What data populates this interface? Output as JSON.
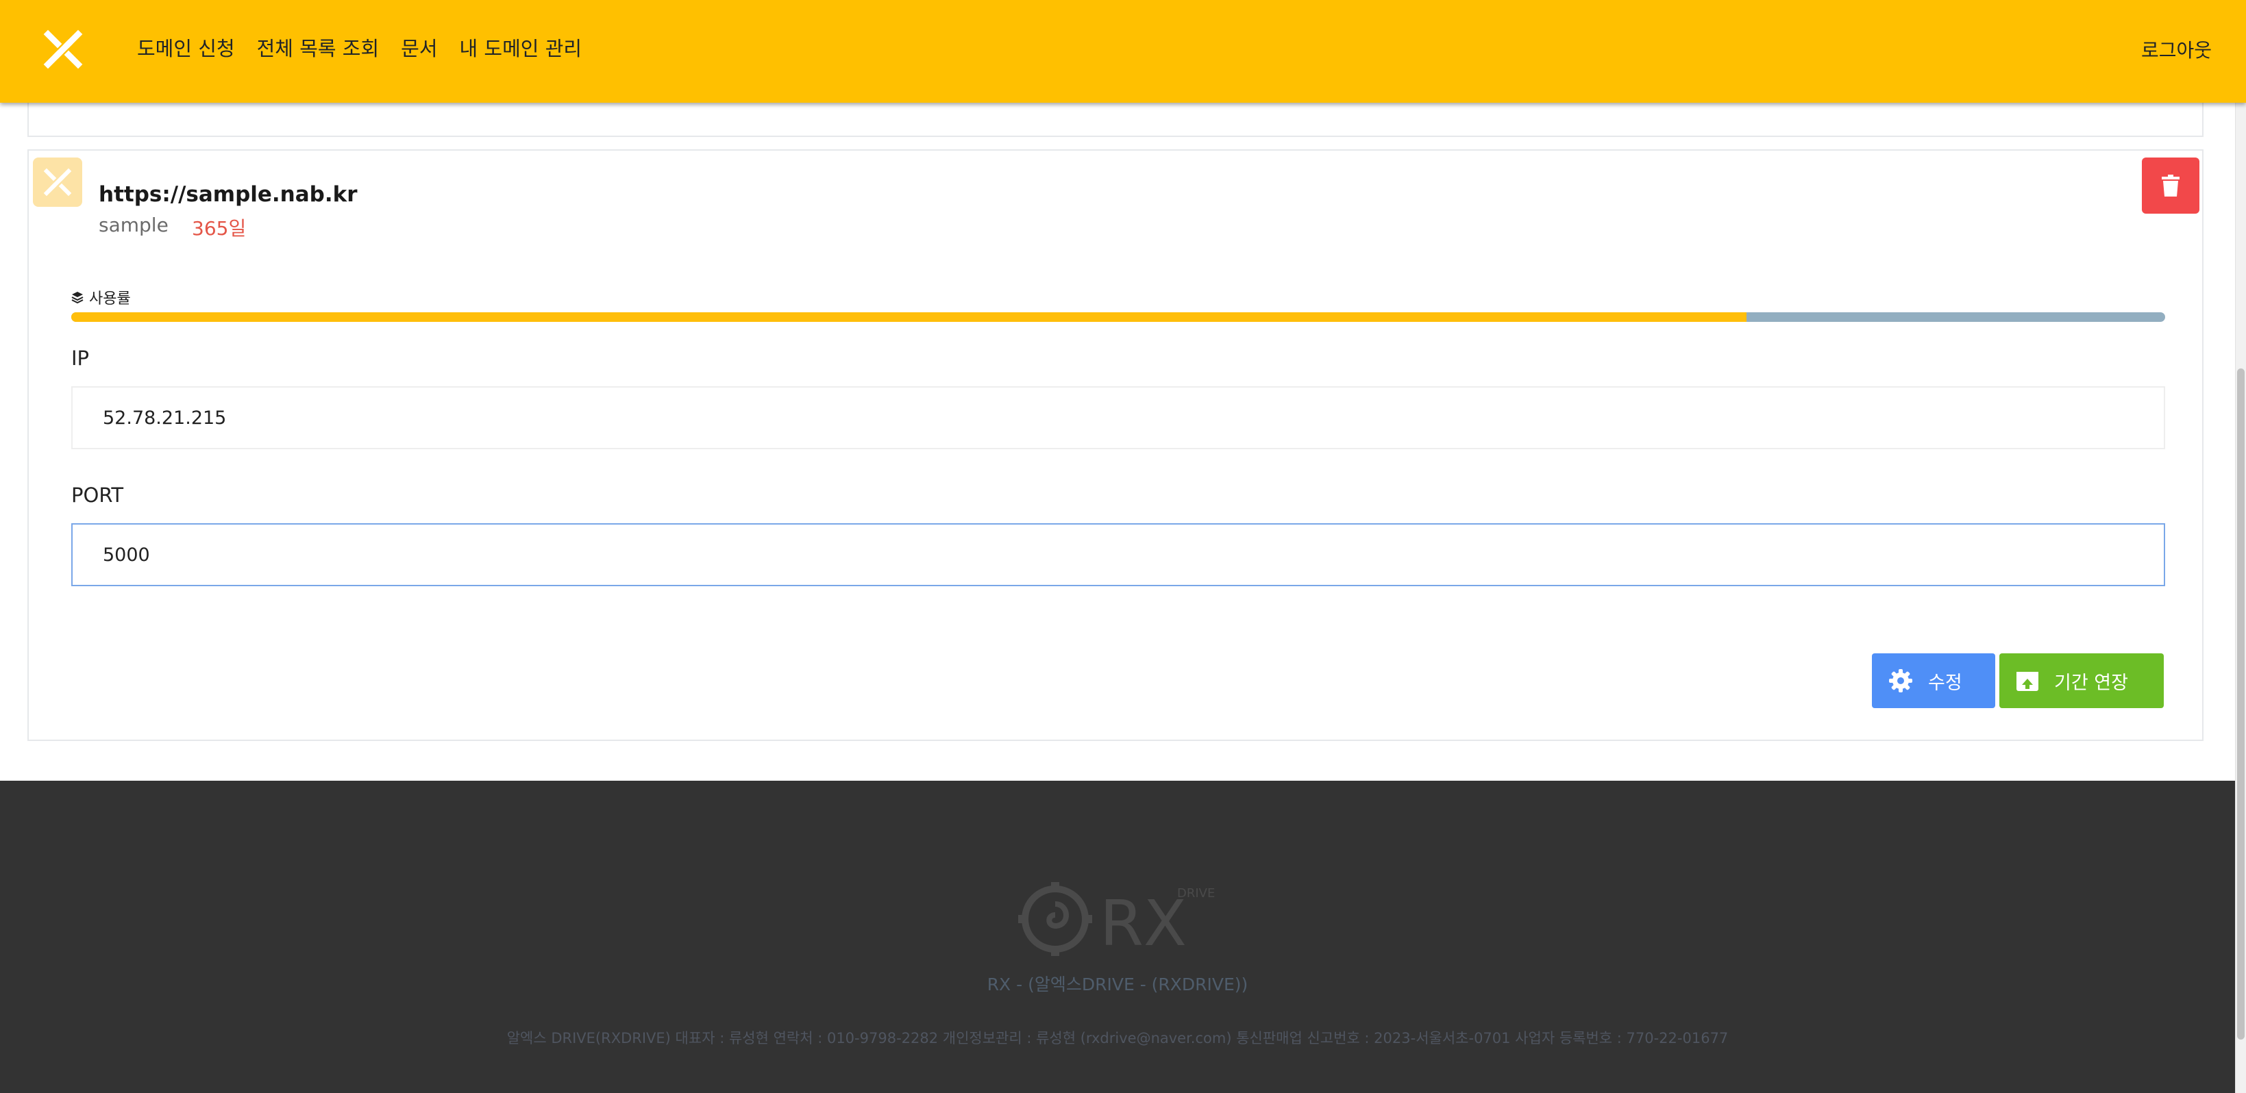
{
  "header": {
    "nav": [
      {
        "label": "도메인 신청"
      },
      {
        "label": "전체 목록 조회"
      },
      {
        "label": "문서"
      },
      {
        "label": "내 도메인 관리"
      }
    ],
    "logout_label": "로그아웃",
    "brand_color": "#ffc000"
  },
  "domain": {
    "url": "https://sample.nab.kr",
    "name": "sample",
    "days_left": "365일",
    "usage_label": "사용률",
    "usage_percent": 80,
    "ip_label": "IP",
    "ip_value": "52.78.21.215",
    "port_label": "PORT",
    "port_value": "5000",
    "edit_label": "수정",
    "extend_label": "기간 연장",
    "delete_icon": "trash-icon"
  },
  "footer": {
    "logo_text": "RX",
    "logo_sub": "DRIVE",
    "brand_line": "RX - (알엑스DRIVE - (RXDRIVE))",
    "info_line": "알엑스 DRIVE(RXDRIVE) 대표자 : 류성현 연락처 : 010-9798-2282 개인정보관리 : 류성현 (rxdrive@naver.com) 통신판매업 신고번호 : 2023-서울서초-0701 사업자 등록번호 : 770-22-01677"
  }
}
